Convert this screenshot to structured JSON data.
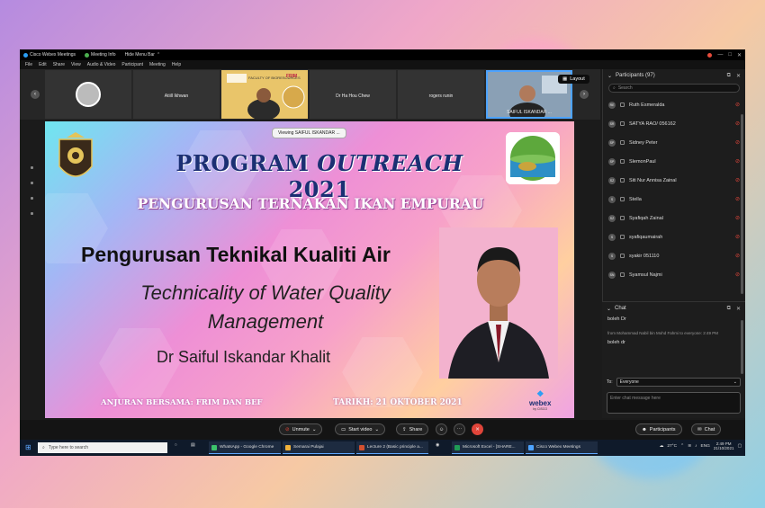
{
  "window": {
    "app_title": "Cisco Webex Meetings",
    "meeting_info": "Meeting Info",
    "hide_menu": "Hide Menu Bar"
  },
  "menu": [
    "File",
    "Edit",
    "Share",
    "View",
    "Audio & Video",
    "Participant",
    "Meeting",
    "Help"
  ],
  "strip": {
    "tiles": [
      {
        "name": ""
      },
      {
        "name": "Atiill Ikhwan"
      },
      {
        "name": ""
      },
      {
        "name": "Dr Ha Hou Chew"
      },
      {
        "name": "rogers runin"
      },
      {
        "name": "SAIFUL ISKANDAR ..."
      }
    ],
    "layout_label": "Layout"
  },
  "slide": {
    "viewing": "Viewing SAIFUL ISKANDAR ...",
    "program_title_a": "PROGRAM ",
    "program_title_b": "OUTREACH",
    "program_title_c": " 2021",
    "subtitle": "PENGURUSAN TERNAKAN IKAN EMPURAU",
    "topic_ms": "Pengurusan Teknikal Kualiti Air",
    "topic_en": "Technicality of Water Quality Management",
    "presenter": "Dr Saiful Iskandar Khalit",
    "footer_left": "ANJURAN BERSAMA: FRIM DAN BEF",
    "footer_right": "TARIKH: 21 OKTOBER 2021",
    "webex_label": "webex",
    "webex_sub": "by CISCO",
    "frim_label": "FRIM"
  },
  "participants": {
    "header": "Participants (97)",
    "search_placeholder": "Search",
    "list": [
      {
        "initials": "RE",
        "name": "Ruth Esmeralda"
      },
      {
        "initials": "SR",
        "name": "SATYA RAO/ 056162"
      },
      {
        "initials": "SP",
        "name": "Sidney Peter"
      },
      {
        "initials": "SP",
        "name": "SlemonPaul"
      },
      {
        "initials": "SZ",
        "name": "Siti Nur Annisa Zainal"
      },
      {
        "initials": "S",
        "name": "Stella"
      },
      {
        "initials": "SZ",
        "name": "Syafiqah Zainal"
      },
      {
        "initials": "S",
        "name": "syafiqaumairah"
      },
      {
        "initials": "S",
        "name": "syakir 051110"
      },
      {
        "initials": "SN",
        "name": "Syamsul Najmi"
      }
    ]
  },
  "chat": {
    "header": "Chat",
    "messages": [
      {
        "type": "msg",
        "text": "boleh Dr"
      },
      {
        "type": "meta",
        "text": "from Mohammad Nabil bin Mohd Fahmi to everyone: 2:49 PM"
      },
      {
        "type": "msg",
        "text": "boleh dr"
      }
    ],
    "to_label": "To:",
    "to_value": "Everyone",
    "input_placeholder": "Enter chat message here"
  },
  "controls": {
    "unmute": "Unmute",
    "start_video": "Start video",
    "share": "Share",
    "participants": "Participants",
    "chat": "Chat"
  },
  "taskbar": {
    "search_placeholder": "Type here to search",
    "apps": [
      {
        "label": "WhatsApp - Google Chrome",
        "color": "#3cc26b"
      },
      {
        "label": "Semarai Pulajai",
        "color": "#f0b13a"
      },
      {
        "label": "Lecture 2 (Basic principle a...",
        "color": "#d2502f"
      },
      {
        "label": "Microsoft Excel - [SHARE...",
        "color": "#1f9b55"
      },
      {
        "label": "Cisco Webex Meetings",
        "color": "#4da3ff"
      }
    ],
    "temp": "27°C",
    "lang": "ENG",
    "time": "2:49 PM",
    "date": "21/10/2021"
  }
}
